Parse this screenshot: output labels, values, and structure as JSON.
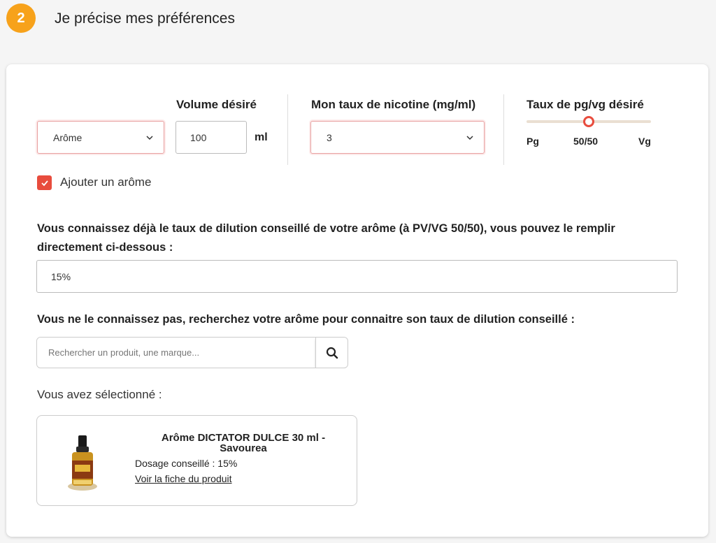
{
  "step": {
    "number": "2",
    "title": "Je précise mes préférences"
  },
  "form": {
    "type_select": {
      "value": "Arôme"
    },
    "volume": {
      "label": "Volume désiré",
      "value": "100",
      "unit": "ml"
    },
    "nicotine": {
      "label": "Mon taux de nicotine (mg/ml)",
      "value": "3"
    },
    "pgvg": {
      "label": "Taux de pg/vg désiré",
      "min_label": "Pg",
      "mid_label": "50/50",
      "max_label": "Vg",
      "value_fraction": 0.5
    },
    "add_aroma": {
      "label": "Ajouter un arôme",
      "checked": true
    },
    "dilution": {
      "question": "Vous connaissez déjà le taux de dilution conseillé de votre arôme (à PV/VG 50/50), vous pouvez le remplir directement ci-dessous :",
      "value": "15%"
    },
    "search": {
      "question": "Vous ne le connaissez pas, recherchez votre arôme pour connaitre son taux de dilution conseillé :",
      "placeholder": "Rechercher un produit, une marque..."
    },
    "selected": {
      "label": "Vous avez sélectionné :",
      "product_title": "Arôme DICTATOR DULCE 30 ml - Savourea",
      "dosage": "Dosage conseillé : 15%",
      "link": "Voir la fiche du produit"
    }
  },
  "colors": {
    "badge": "#f7a21b",
    "accent": "#e84c3d"
  },
  "icons": {
    "select_chevron": "chevron-down-icon",
    "search": "search-icon",
    "checkbox": "check-icon"
  }
}
